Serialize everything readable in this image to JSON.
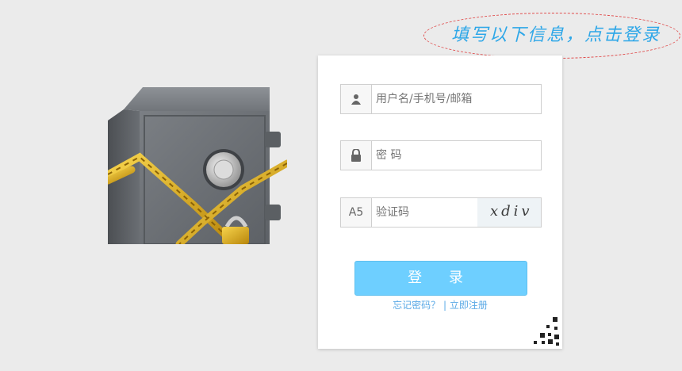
{
  "hint": {
    "text": "填写以下信息，点击登录"
  },
  "form": {
    "username_placeholder": "用户名/手机号/邮箱",
    "password_placeholder": "密 码",
    "captcha_prefix": "A5",
    "captcha_placeholder": "验证码",
    "captcha_image_text": "xdiv",
    "login_button": "登 录",
    "forgot_link": "忘记密码？",
    "separator": "|",
    "register_link": "立即注册"
  },
  "icons": {
    "user": "user-icon",
    "lock": "lock-icon",
    "qr": "qrcode-icon"
  },
  "colors": {
    "accent": "#6ecfff",
    "link": "#5aa9e6",
    "hint_text": "#2ea7e8",
    "hint_border": "#e04a4a"
  }
}
